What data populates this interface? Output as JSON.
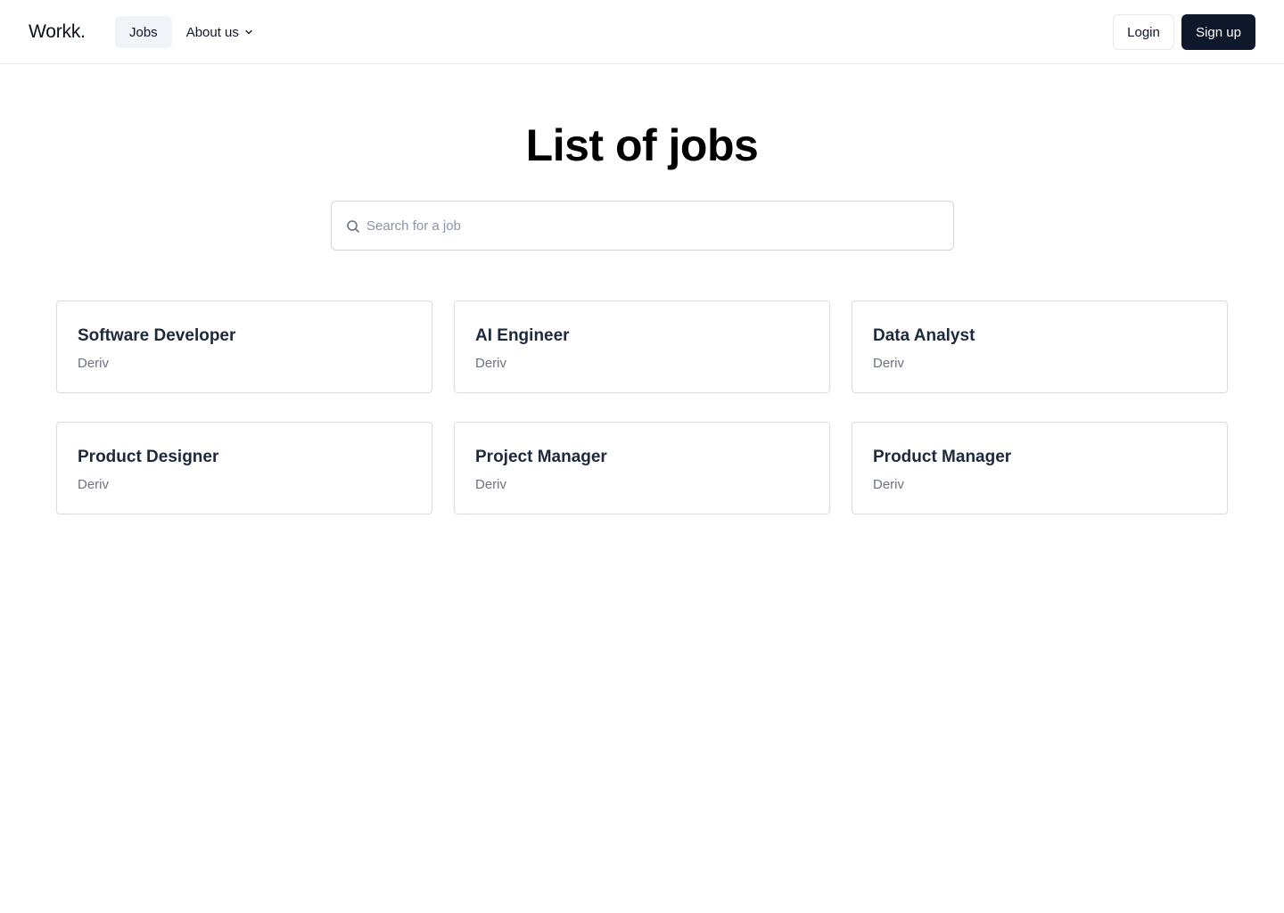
{
  "header": {
    "logo": "Workk.",
    "nav": {
      "jobs_label": "Jobs",
      "about_label": "About us",
      "about_icon": "chevron-down-icon"
    },
    "login_label": "Login",
    "signup_label": "Sign up"
  },
  "main": {
    "title": "List of jobs",
    "search": {
      "placeholder": "Search for a job",
      "value": "",
      "icon": "search-icon"
    },
    "jobs": [
      {
        "title": "Software Developer",
        "company": "Deriv"
      },
      {
        "title": "AI Engineer",
        "company": "Deriv"
      },
      {
        "title": "Data Analyst",
        "company": "Deriv"
      },
      {
        "title": "Product Designer",
        "company": "Deriv"
      },
      {
        "title": "Project Manager",
        "company": "Deriv"
      },
      {
        "title": "Product Manager",
        "company": "Deriv"
      }
    ]
  },
  "colors": {
    "primary": "#0f172a",
    "border": "#e5e7eb",
    "active_nav_bg": "#f1f5f9",
    "muted_text": "#6b7280"
  }
}
